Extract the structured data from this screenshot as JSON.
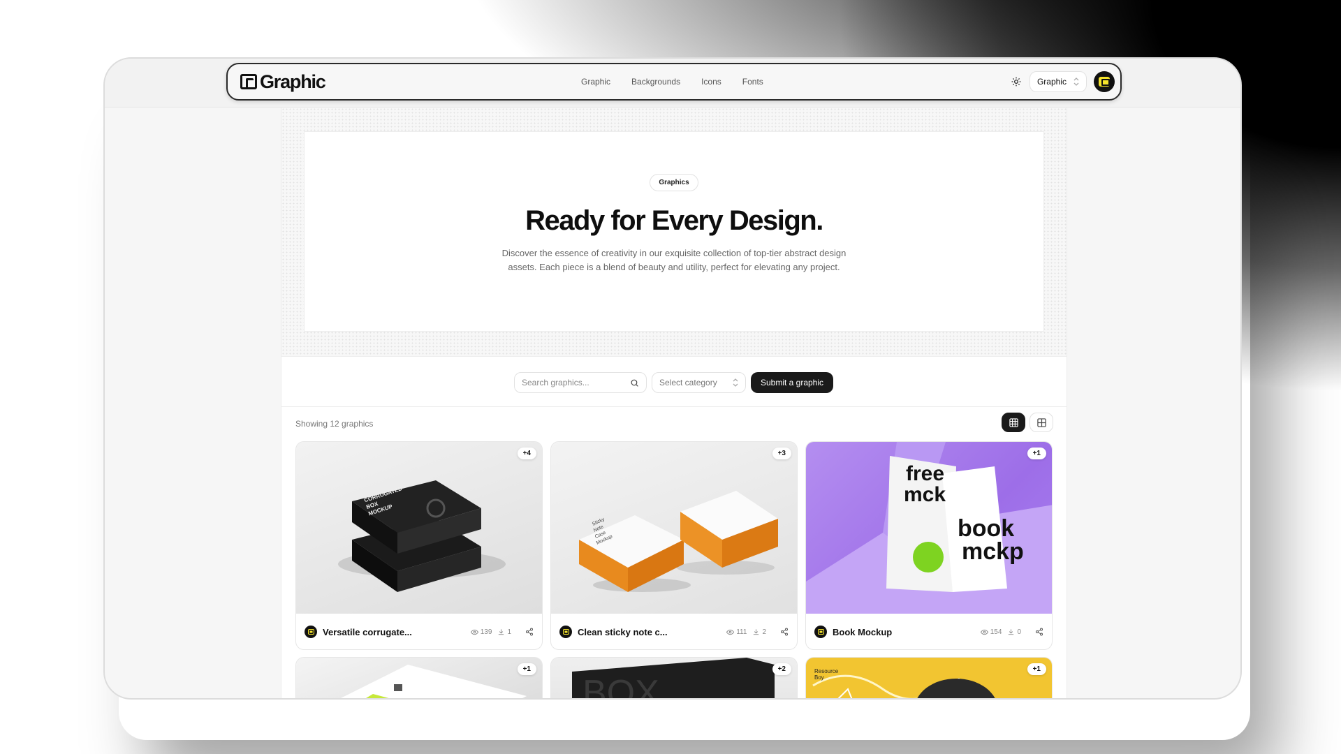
{
  "nav": {
    "logo_text": "Graphic",
    "links": [
      "Graphic",
      "Backgrounds",
      "Icons",
      "Fonts"
    ],
    "site_select": "Graphic"
  },
  "hero": {
    "pill": "Graphics",
    "title": "Ready for Every Design.",
    "description": "Discover the essence of creativity in our exquisite collection of top-tier abstract design assets. Each piece is a blend of beauty and utility, perfect for elevating any project."
  },
  "toolbar": {
    "search_placeholder": "Search graphics...",
    "category_placeholder": "Select category",
    "submit_label": "Submit a graphic"
  },
  "results": {
    "showing": "Showing 12 graphics"
  },
  "cards": [
    {
      "badge": "+4",
      "title": "Versatile corrugate...",
      "views": "139",
      "downloads": "1",
      "thumb_text": [
        "CORRUGATED",
        "BOX",
        "MOCKUP"
      ]
    },
    {
      "badge": "+3",
      "title": "Clean sticky note c...",
      "views": "111",
      "downloads": "2",
      "thumb_text": [
        "Sticky",
        "Note",
        "Case",
        "Mockup"
      ]
    },
    {
      "badge": "+1",
      "title": "Book Mockup",
      "views": "154",
      "downloads": "0",
      "thumb_text": [
        "free",
        "mck",
        "book",
        "mckp"
      ]
    },
    {
      "badge": "+1"
    },
    {
      "badge": "+2",
      "thumb_text": [
        "BOX"
      ]
    },
    {
      "badge": "+1",
      "thumb_text": [
        "Resource",
        "Boy"
      ]
    }
  ],
  "colors": {
    "accent_yellow": "#f4e32b",
    "dark": "#1a1a1a",
    "purple": "#a47ceb",
    "orange": "#e8891e"
  },
  "icons": {
    "theme": "sun-icon",
    "search": "search-icon",
    "views": "eye-icon",
    "downloads": "download-icon",
    "share": "share-icon",
    "grid_view": "grid-icon",
    "table_view": "table-icon"
  }
}
